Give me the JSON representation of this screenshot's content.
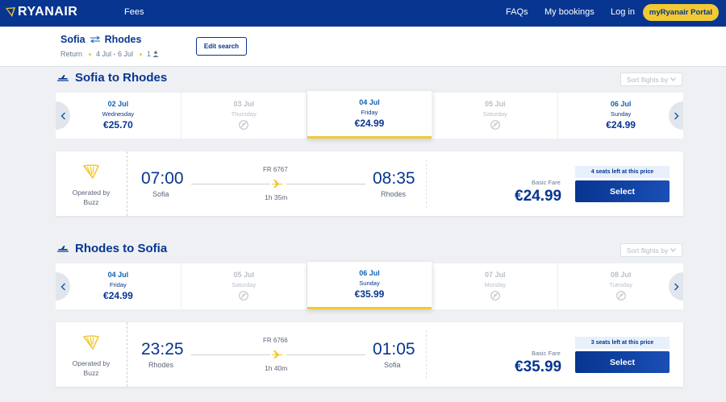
{
  "nav": {
    "brand": "RYANAIR",
    "fees": "Fees",
    "faqs": "FAQs",
    "my_bookings": "My bookings",
    "login": "Log in",
    "portal": "myRyanair Portal"
  },
  "summary": {
    "origin": "Sofia",
    "destination": "Rhodes",
    "trip_type": "Return",
    "dates": "4 Jul - 6 Jul",
    "passengers": "1",
    "edit_label": "Edit search"
  },
  "outbound": {
    "title": "Sofia to Rhodes",
    "sort_label": "Sort flights by",
    "dates": [
      {
        "date": "02 Jul",
        "weekday": "Wednesday",
        "price": "€25.70",
        "available": true
      },
      {
        "date": "03 Jul",
        "weekday": "Thursday",
        "price": "",
        "available": false
      },
      {
        "date": "04 Jul",
        "weekday": "Friday",
        "price": "€24.99",
        "available": true,
        "selected": true
      },
      {
        "date": "05 Jul",
        "weekday": "Saturday",
        "price": "",
        "available": false
      },
      {
        "date": "06 Jul",
        "weekday": "Sunday",
        "price": "€24.99",
        "available": true
      }
    ],
    "flight": {
      "operated_by": "Operated by",
      "operator": "Buzz",
      "depart_time": "07:00",
      "depart_city": "Sofia",
      "flight_number": "FR 6767",
      "duration": "1h 35m",
      "arrive_time": "08:35",
      "arrive_city": "Rhodes",
      "seats_left": "4 seats left at this price",
      "fare_label": "Basic Fare",
      "price": "€24.99",
      "select_label": "Select"
    }
  },
  "inbound": {
    "title": "Rhodes to Sofia",
    "sort_label": "Sort flights by",
    "dates": [
      {
        "date": "04 Jul",
        "weekday": "Friday",
        "price": "€24.99",
        "available": true
      },
      {
        "date": "05 Jul",
        "weekday": "Saturday",
        "price": "",
        "available": false
      },
      {
        "date": "06 Jul",
        "weekday": "Sunday",
        "price": "€35.99",
        "available": true,
        "selected": true
      },
      {
        "date": "07 Jul",
        "weekday": "Monday",
        "price": "",
        "available": false
      },
      {
        "date": "08 Jul",
        "weekday": "Tuesday",
        "price": "",
        "available": false
      }
    ],
    "flight": {
      "operated_by": "Operated by",
      "operator": "Buzz",
      "depart_time": "23:25",
      "depart_city": "Rhodes",
      "flight_number": "FR 6766",
      "duration": "1h 40m",
      "arrive_time": "01:05",
      "arrive_city": "Sofia",
      "seats_left": "3 seats left at this price",
      "fare_label": "Basic Fare",
      "price": "€35.99",
      "select_label": "Select"
    }
  },
  "colors": {
    "brand_blue": "#073590",
    "accent_yellow": "#f1c933",
    "background": "#eef0f3"
  }
}
